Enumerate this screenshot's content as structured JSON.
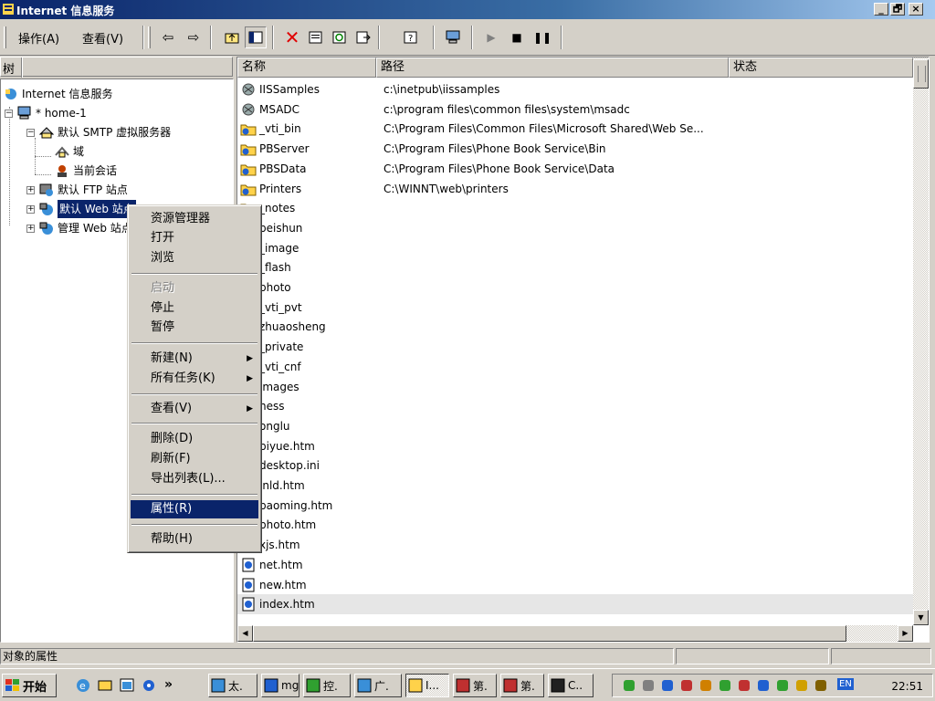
{
  "window": {
    "title": "Internet 信息服务",
    "minimize": "_",
    "restore": "🗗",
    "close": "×"
  },
  "menu": {
    "action": "操作(A)",
    "view": "查看(V)"
  },
  "toolbar": {
    "icons": [
      "back-icon",
      "forward-icon",
      "up-folder-icon",
      "show-tree-icon",
      "delete-icon",
      "properties-icon",
      "refresh-icon",
      "export-icon",
      "help-icon",
      "computer-icon",
      "start-icon",
      "stop-icon",
      "pause-icon"
    ]
  },
  "tree": {
    "header": "树",
    "nodes": {
      "root": "Internet 信息服务",
      "server": "* home-1",
      "smtp": "默认 SMTP 虚拟服务器",
      "domain": "域",
      "session": "当前会话",
      "ftp": "默认 FTP 站点",
      "web": "默认 Web 站点",
      "admin": "管理 Web 站点"
    }
  },
  "list": {
    "columns": {
      "name": "名称",
      "path": "路径",
      "status": "状态"
    },
    "rows": [
      {
        "name": "IISSamples",
        "path": "c:\\inetpub\\iissamples",
        "icon": "virtual-dir-icon"
      },
      {
        "name": "MSADC",
        "path": "c:\\program files\\common files\\system\\msadc",
        "icon": "virtual-dir-icon"
      },
      {
        "name": "_vti_bin",
        "path": "C:\\Program Files\\Common Files\\Microsoft Shared\\Web Se...",
        "icon": "web-folder-icon"
      },
      {
        "name": "PBServer",
        "path": "C:\\Program Files\\Phone Book Service\\Bin",
        "icon": "web-folder-icon"
      },
      {
        "name": "PBSData",
        "path": "C:\\Program Files\\Phone Book Service\\Data",
        "icon": "web-folder-icon"
      },
      {
        "name": "Printers",
        "path": "C:\\WINNT\\web\\printers",
        "icon": "web-folder-icon"
      },
      {
        "name": "_notes",
        "path": "",
        "icon": "folder-icon"
      },
      {
        "name": "beishun",
        "path": "",
        "icon": "folder-icon"
      },
      {
        "name": "_image",
        "path": "",
        "icon": "folder-icon"
      },
      {
        "name": "_flash",
        "path": "",
        "icon": "folder-icon"
      },
      {
        "name": "photo",
        "path": "",
        "icon": "folder-icon"
      },
      {
        "name": "_vti_pvt",
        "path": "",
        "icon": "folder-icon"
      },
      {
        "name": "zhuaosheng",
        "path": "",
        "icon": "folder-icon"
      },
      {
        "name": "_private",
        "path": "",
        "icon": "folder-icon"
      },
      {
        "name": "_vti_cnf",
        "path": "",
        "icon": "folder-icon"
      },
      {
        "name": "images",
        "path": "",
        "icon": "folder-icon"
      },
      {
        "name": "ness",
        "path": "",
        "icon": "folder-icon"
      },
      {
        "name": "onglu",
        "path": "",
        "icon": "folder-icon"
      },
      {
        "name": "biyue.htm",
        "path": "",
        "icon": "htm-file-icon"
      },
      {
        "name": "desktop.ini",
        "path": "",
        "icon": "file-icon"
      },
      {
        "name": "inld.htm",
        "path": "",
        "icon": "htm-file-icon"
      },
      {
        "name": "baoming.htm",
        "path": "",
        "icon": "htm-file-icon"
      },
      {
        "name": "photo.htm",
        "path": "",
        "icon": "htm-file-icon"
      },
      {
        "name": "xjs.htm",
        "path": "",
        "icon": "htm-file-icon"
      },
      {
        "name": "net.htm",
        "path": "",
        "icon": "htm-file-icon"
      },
      {
        "name": "new.htm",
        "path": "",
        "icon": "htm-file-icon"
      },
      {
        "name": "index.htm",
        "path": "",
        "icon": "htm-file-icon"
      }
    ]
  },
  "context_menu": {
    "explorer": "资源管理器",
    "open": "打开",
    "browse": "浏览",
    "start": "启动",
    "stop": "停止",
    "pause": "暂停",
    "new": "新建(N)",
    "all_tasks": "所有任务(K)",
    "view": "查看(V)",
    "delete": "删除(D)",
    "refresh": "刷新(F)",
    "export": "导出列表(L)...",
    "properties": "属性(R)",
    "help": "帮助(H)",
    "submenu_arrow": "▶"
  },
  "status": {
    "text": "对象的属性"
  },
  "taskbar": {
    "start": "开始",
    "chevron": "»",
    "tasks": [
      "太.",
      "mg",
      "控.",
      "广.",
      "I...",
      "第.",
      "第.",
      "C.."
    ],
    "clock": "22:51",
    "ime": "EN"
  },
  "colors": {
    "title_active": "#0a246a",
    "selection": "#0a246a",
    "face": "#d4d0c8"
  }
}
